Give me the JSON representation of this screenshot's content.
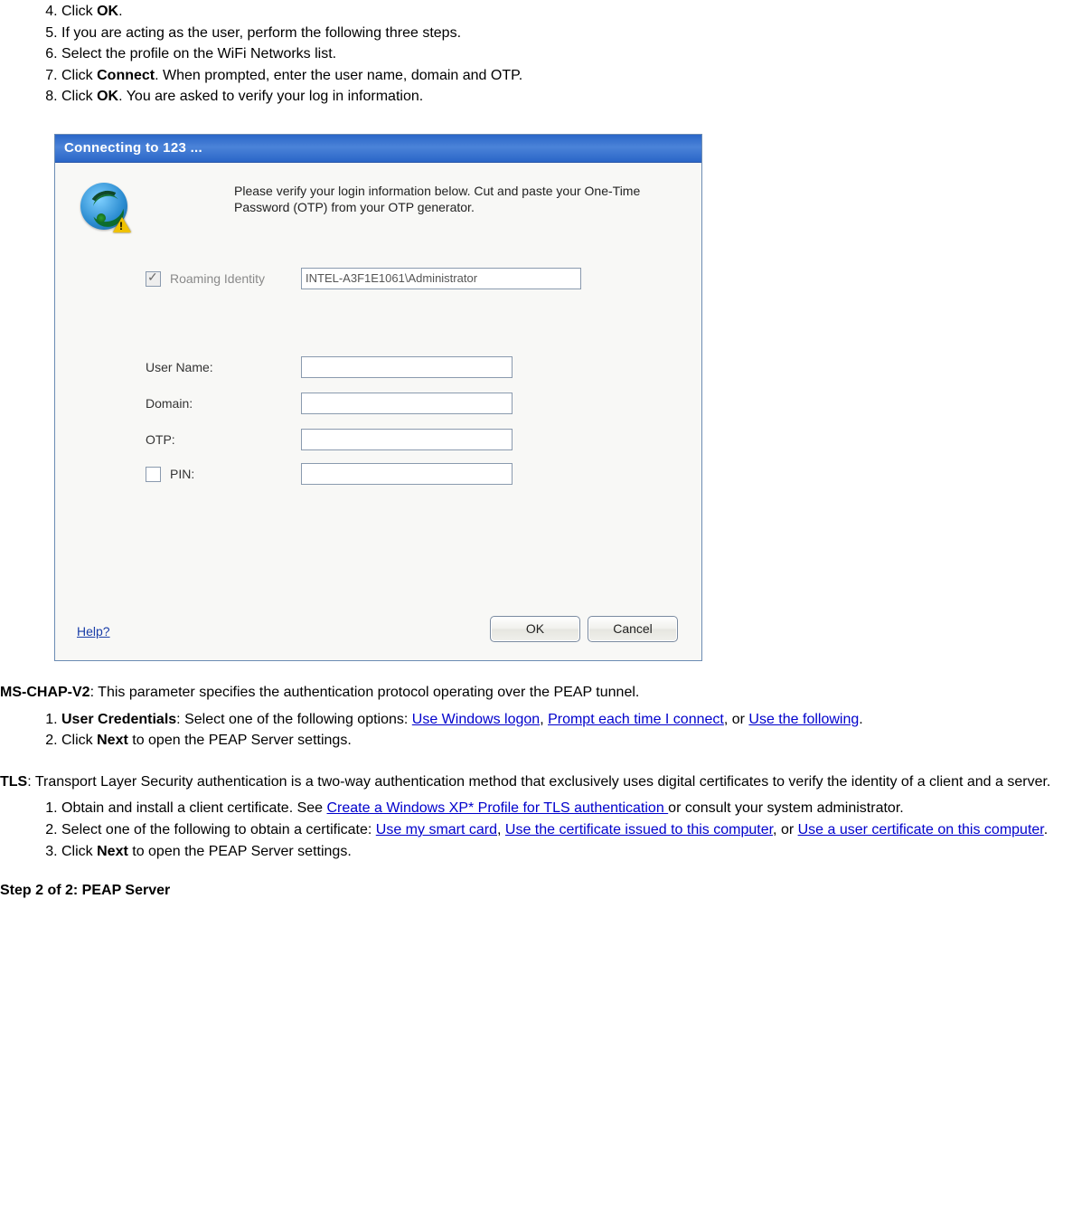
{
  "steps_a": [
    {
      "n": "4.",
      "pre": "Click ",
      "bold": "OK",
      "post": "."
    },
    {
      "n": "5.",
      "text": "If you are acting as the user, perform the following three steps."
    },
    {
      "n": "6.",
      "text": "Select the profile on the WiFi Networks list."
    },
    {
      "n": "7.",
      "pre": "Click ",
      "bold": "Connect",
      "post": ". When prompted, enter the user name, domain and OTP."
    },
    {
      "n": "8.",
      "pre": "Click ",
      "bold": "OK",
      "post": ". You are asked to verify your log in information."
    }
  ],
  "dialog": {
    "title": "Connecting to 123 ...",
    "instruction": "Please verify your login information below. Cut and paste your One-Time Password (OTP) from your OTP generator.",
    "roaming_label": "Roaming Identity",
    "roaming_value": "INTEL-A3F1E1061\\Administrator",
    "labels": {
      "user": "User Name:",
      "domain": "Domain:",
      "otp": "OTP:",
      "pin": "PIN:"
    },
    "help": "Help?",
    "ok": "OK",
    "cancel": "Cancel"
  },
  "mschap": {
    "lead_bold": "MS-CHAP-V2",
    "lead_rest": ": This parameter specifies the authentication protocol operating over the PEAP tunnel.",
    "li1_bold": "User Credentials",
    "li1_pre": ": Select one of the following options: ",
    "li1_link1": "Use Windows logon",
    "li1_mid1": ", ",
    "li1_link2": "Prompt each time I connect",
    "li1_mid2": ", or ",
    "li1_link3": "Use the following",
    "li1_post": ".",
    "li2_pre": "Click ",
    "li2_bold": "Next",
    "li2_post": " to open the PEAP Server settings."
  },
  "tls": {
    "lead_bold": "TLS",
    "lead_rest": ": Transport Layer Security authentication is a two-way authentication method that exclusively uses digital certificates to verify the identity of a client and a server.",
    "li1_pre": "Obtain and install a client certificate. See ",
    "li1_link": "Create a Windows XP* Profile for TLS authentication ",
    "li1_post": "or consult your system administrator.",
    "li2_pre": "Select one of the following to obtain a certificate: ",
    "li2_link1": "Use my smart card",
    "li2_mid1": ", ",
    "li2_link2": "Use the certificate issued to this computer",
    "li2_mid2": ", or ",
    "li2_link3": "Use a user certificate on this computer",
    "li2_post": ".",
    "li3_pre": "Click ",
    "li3_bold": "Next",
    "li3_post": " to open the PEAP Server settings."
  },
  "step2_heading": "Step 2 of 2: PEAP Server"
}
